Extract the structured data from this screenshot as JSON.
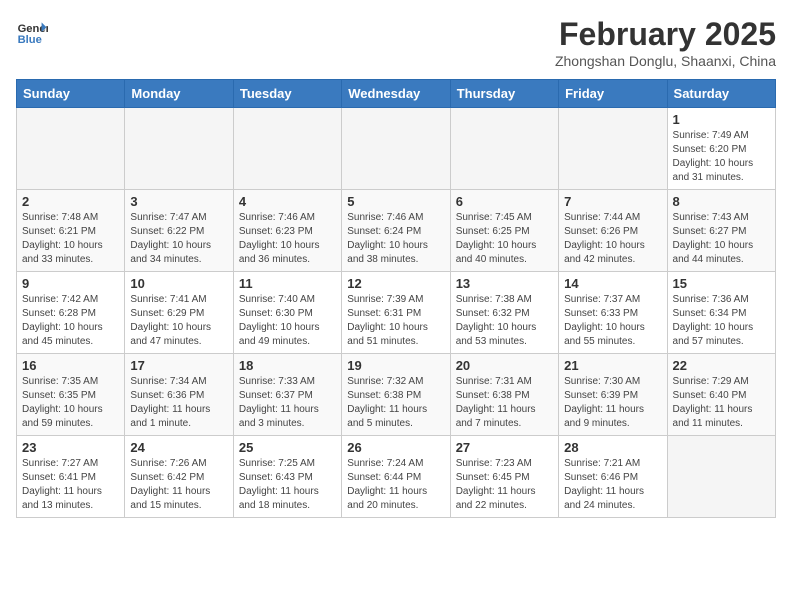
{
  "header": {
    "logo_line1": "General",
    "logo_line2": "Blue",
    "month_title": "February 2025",
    "location": "Zhongshan Donglu, Shaanxi, China"
  },
  "weekdays": [
    "Sunday",
    "Monday",
    "Tuesday",
    "Wednesday",
    "Thursday",
    "Friday",
    "Saturday"
  ],
  "weeks": [
    [
      {
        "day": "",
        "info": ""
      },
      {
        "day": "",
        "info": ""
      },
      {
        "day": "",
        "info": ""
      },
      {
        "day": "",
        "info": ""
      },
      {
        "day": "",
        "info": ""
      },
      {
        "day": "",
        "info": ""
      },
      {
        "day": "1",
        "info": "Sunrise: 7:49 AM\nSunset: 6:20 PM\nDaylight: 10 hours and 31 minutes."
      }
    ],
    [
      {
        "day": "2",
        "info": "Sunrise: 7:48 AM\nSunset: 6:21 PM\nDaylight: 10 hours and 33 minutes."
      },
      {
        "day": "3",
        "info": "Sunrise: 7:47 AM\nSunset: 6:22 PM\nDaylight: 10 hours and 34 minutes."
      },
      {
        "day": "4",
        "info": "Sunrise: 7:46 AM\nSunset: 6:23 PM\nDaylight: 10 hours and 36 minutes."
      },
      {
        "day": "5",
        "info": "Sunrise: 7:46 AM\nSunset: 6:24 PM\nDaylight: 10 hours and 38 minutes."
      },
      {
        "day": "6",
        "info": "Sunrise: 7:45 AM\nSunset: 6:25 PM\nDaylight: 10 hours and 40 minutes."
      },
      {
        "day": "7",
        "info": "Sunrise: 7:44 AM\nSunset: 6:26 PM\nDaylight: 10 hours and 42 minutes."
      },
      {
        "day": "8",
        "info": "Sunrise: 7:43 AM\nSunset: 6:27 PM\nDaylight: 10 hours and 44 minutes."
      }
    ],
    [
      {
        "day": "9",
        "info": "Sunrise: 7:42 AM\nSunset: 6:28 PM\nDaylight: 10 hours and 45 minutes."
      },
      {
        "day": "10",
        "info": "Sunrise: 7:41 AM\nSunset: 6:29 PM\nDaylight: 10 hours and 47 minutes."
      },
      {
        "day": "11",
        "info": "Sunrise: 7:40 AM\nSunset: 6:30 PM\nDaylight: 10 hours and 49 minutes."
      },
      {
        "day": "12",
        "info": "Sunrise: 7:39 AM\nSunset: 6:31 PM\nDaylight: 10 hours and 51 minutes."
      },
      {
        "day": "13",
        "info": "Sunrise: 7:38 AM\nSunset: 6:32 PM\nDaylight: 10 hours and 53 minutes."
      },
      {
        "day": "14",
        "info": "Sunrise: 7:37 AM\nSunset: 6:33 PM\nDaylight: 10 hours and 55 minutes."
      },
      {
        "day": "15",
        "info": "Sunrise: 7:36 AM\nSunset: 6:34 PM\nDaylight: 10 hours and 57 minutes."
      }
    ],
    [
      {
        "day": "16",
        "info": "Sunrise: 7:35 AM\nSunset: 6:35 PM\nDaylight: 10 hours and 59 minutes."
      },
      {
        "day": "17",
        "info": "Sunrise: 7:34 AM\nSunset: 6:36 PM\nDaylight: 11 hours and 1 minute."
      },
      {
        "day": "18",
        "info": "Sunrise: 7:33 AM\nSunset: 6:37 PM\nDaylight: 11 hours and 3 minutes."
      },
      {
        "day": "19",
        "info": "Sunrise: 7:32 AM\nSunset: 6:38 PM\nDaylight: 11 hours and 5 minutes."
      },
      {
        "day": "20",
        "info": "Sunrise: 7:31 AM\nSunset: 6:38 PM\nDaylight: 11 hours and 7 minutes."
      },
      {
        "day": "21",
        "info": "Sunrise: 7:30 AM\nSunset: 6:39 PM\nDaylight: 11 hours and 9 minutes."
      },
      {
        "day": "22",
        "info": "Sunrise: 7:29 AM\nSunset: 6:40 PM\nDaylight: 11 hours and 11 minutes."
      }
    ],
    [
      {
        "day": "23",
        "info": "Sunrise: 7:27 AM\nSunset: 6:41 PM\nDaylight: 11 hours and 13 minutes."
      },
      {
        "day": "24",
        "info": "Sunrise: 7:26 AM\nSunset: 6:42 PM\nDaylight: 11 hours and 15 minutes."
      },
      {
        "day": "25",
        "info": "Sunrise: 7:25 AM\nSunset: 6:43 PM\nDaylight: 11 hours and 18 minutes."
      },
      {
        "day": "26",
        "info": "Sunrise: 7:24 AM\nSunset: 6:44 PM\nDaylight: 11 hours and 20 minutes."
      },
      {
        "day": "27",
        "info": "Sunrise: 7:23 AM\nSunset: 6:45 PM\nDaylight: 11 hours and 22 minutes."
      },
      {
        "day": "28",
        "info": "Sunrise: 7:21 AM\nSunset: 6:46 PM\nDaylight: 11 hours and 24 minutes."
      },
      {
        "day": "",
        "info": ""
      }
    ]
  ]
}
